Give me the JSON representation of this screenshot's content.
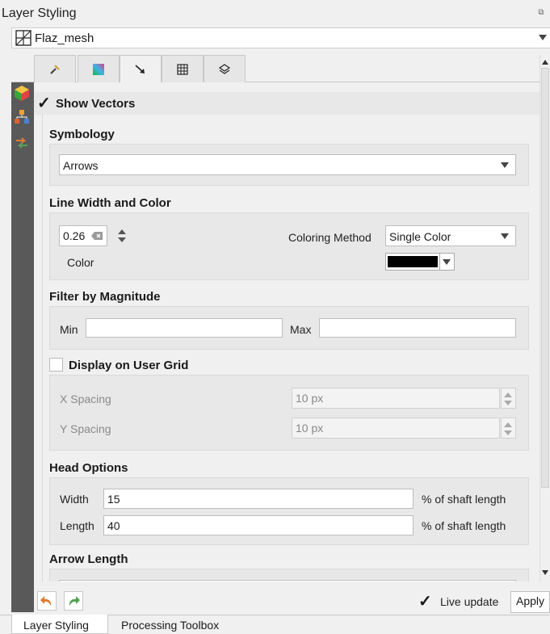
{
  "panel": {
    "title": "Layer Styling",
    "float_icon": "⧉"
  },
  "layer": {
    "name": "Flaz_mesh"
  },
  "tabs": [
    {
      "icon": "wrench-icon"
    },
    {
      "icon": "gradient-icon"
    },
    {
      "icon": "vector-arrow-icon",
      "active": true
    },
    {
      "icon": "grid-icon"
    },
    {
      "icon": "3d-layers-icon"
    }
  ],
  "show_vectors": {
    "label": "Show Vectors",
    "checked": true
  },
  "symbology": {
    "title": "Symbology",
    "value": "Arrows"
  },
  "line_width_color": {
    "title": "Line Width and Color",
    "width_value": "0.26",
    "coloring_method_label": "Coloring Method",
    "coloring_method_value": "Single Color",
    "color_label": "Color",
    "color_value": "#000000"
  },
  "filter_by_magnitude": {
    "title": "Filter by Magnitude",
    "min_label": "Min",
    "min_value": "",
    "max_label": "Max",
    "max_value": ""
  },
  "user_grid": {
    "label": "Display on User Grid",
    "checked": false,
    "x_spacing_label": "X Spacing",
    "x_spacing_value": "10 px",
    "y_spacing_label": "Y Spacing",
    "y_spacing_value": "10 px"
  },
  "head_options": {
    "title": "Head Options",
    "width_label": "Width",
    "width_value": "15",
    "width_unit": "% of shaft length",
    "length_label": "Length",
    "length_value": "40",
    "length_unit": "% of shaft length"
  },
  "arrow_length": {
    "title": "Arrow Length"
  },
  "bottom": {
    "live_update_label": "Live update",
    "live_update_checked": true,
    "apply_label": "Apply"
  },
  "dock_tabs": [
    {
      "label": "Layer Styling",
      "active": true
    },
    {
      "label": "Processing Toolbox",
      "active": false
    }
  ]
}
